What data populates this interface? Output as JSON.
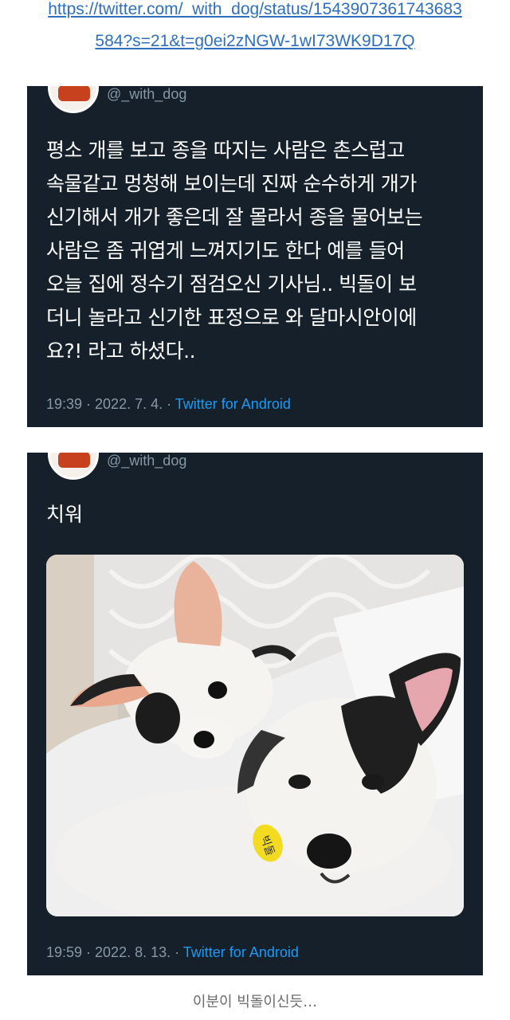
{
  "link": {
    "line1": "https://twitter.com/_with_dog/status/1543907361743683",
    "line2": "584?s=21&t=g0ei2zNGW-1wI73WK9D17Q"
  },
  "tweets": [
    {
      "handle": "@_with_dog",
      "text": "평소 개를 보고 종을 따지는 사람은 촌스럽고\n속물같고 멍청해 보이는데 진짜 순수하게 개가\n신기해서 개가 좋은데 잘 몰라서 종을 물어보는\n사람은 좀 귀엽게 느껴지기도 한다 예를 들어\n오늘 집에 정수기 점검오신 기사님.. 빅돌이 보\n더니 놀라고 신기한 표정으로 와 달마시안이에\n요?! 라고 하셨다..",
      "timestamp": "19:39 · 2022. 7. 4. · ",
      "via": "Twitter for Android"
    },
    {
      "handle": "@_with_dog",
      "text": "치워",
      "timestamp": "19:59 · 2022. 8. 13. · ",
      "via": "Twitter for Android",
      "photo": {
        "tag_text": "빅돌"
      }
    }
  ],
  "caption": "이분이 빅돌이신듯…",
  "colors": {
    "card_bg": "#15202b",
    "link": "#2e6fc0",
    "accent": "#1d9bf0",
    "meta": "#8899a6"
  }
}
